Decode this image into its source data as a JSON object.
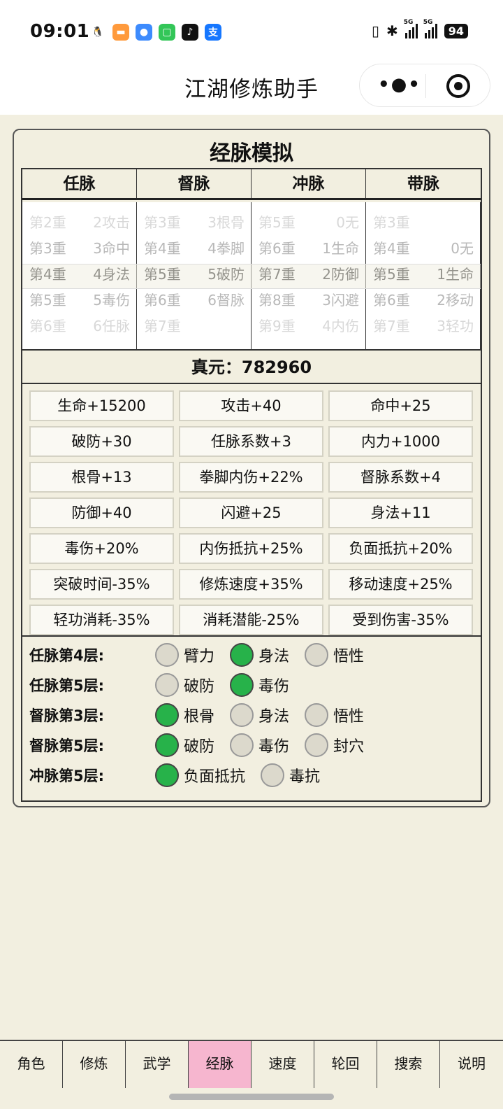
{
  "status_bar": {
    "time": "09:01",
    "apps": [
      {
        "icon": "qq-icon",
        "glyph": "🐧",
        "color": "#ffffff"
      },
      {
        "icon": "wallet-icon",
        "glyph": "▬",
        "color": "#ff9a3c"
      },
      {
        "icon": "browser-icon",
        "glyph": "●",
        "color": "#3d8bfd"
      },
      {
        "icon": "messages-icon",
        "glyph": "▢",
        "color": "#33c658"
      },
      {
        "icon": "tiktok-icon",
        "glyph": "♪",
        "color": "#111111"
      },
      {
        "icon": "alipay-icon",
        "glyph": "支",
        "color": "#1677ff"
      }
    ],
    "network": "5G",
    "battery": "94"
  },
  "header": {
    "title": "江湖修炼助手"
  },
  "panel": {
    "title": "经脉模拟",
    "columns": [
      "任脉",
      "督脉",
      "冲脉",
      "带脉"
    ],
    "pickers": [
      {
        "rows": [
          [
            "第2重",
            "2攻击"
          ],
          [
            "第3重",
            "3命中"
          ],
          [
            "第4重",
            "4身法"
          ],
          [
            "第5重",
            "5毒伤"
          ],
          [
            "第6重",
            "6任脉"
          ]
        ]
      },
      {
        "rows": [
          [
            "第3重",
            "3根骨"
          ],
          [
            "第4重",
            "4拳脚"
          ],
          [
            "第5重",
            "5破防"
          ],
          [
            "第6重",
            "6督脉"
          ],
          [
            "第7重",
            ""
          ]
        ]
      },
      {
        "rows": [
          [
            "第5重",
            "0无"
          ],
          [
            "第6重",
            "1生命"
          ],
          [
            "第7重",
            "2防御"
          ],
          [
            "第8重",
            "3闪避"
          ],
          [
            "第9重",
            "4内伤"
          ]
        ]
      },
      {
        "rows": [
          [
            "第3重",
            ""
          ],
          [
            "第4重",
            "0无"
          ],
          [
            "第5重",
            "1生命"
          ],
          [
            "第6重",
            "2移动"
          ],
          [
            "第7重",
            "3轻功"
          ]
        ]
      }
    ],
    "zhenyuan": "真元：782960",
    "stats": [
      "生命+15200",
      "攻击+40",
      "命中+25",
      "破防+30",
      "任脉系数+3",
      "内力+1000",
      "根骨+13",
      "拳脚内伤+22%",
      "督脉系数+4",
      "防御+40",
      "闪避+25",
      "身法+11",
      "毒伤+20%",
      "内伤抵抗+25%",
      "负面抵抗+20%",
      "突破时间-35%",
      "修炼速度+35%",
      "移动速度+25%",
      "轻功消耗-35%",
      "消耗潜能-25%",
      "受到伤害-35%"
    ],
    "nodes": [
      {
        "label": "任脉第4层:",
        "options": [
          {
            "text": "臂力",
            "on": false
          },
          {
            "text": "身法",
            "on": true
          },
          {
            "text": "悟性",
            "on": false
          }
        ]
      },
      {
        "label": "任脉第5层:",
        "options": [
          {
            "text": "破防",
            "on": false
          },
          {
            "text": "毒伤",
            "on": true
          }
        ]
      },
      {
        "label": "督脉第3层:",
        "options": [
          {
            "text": "根骨",
            "on": true
          },
          {
            "text": "身法",
            "on": false
          },
          {
            "text": "悟性",
            "on": false
          }
        ]
      },
      {
        "label": "督脉第5层:",
        "options": [
          {
            "text": "破防",
            "on": true
          },
          {
            "text": "毒伤",
            "on": false
          },
          {
            "text": "封穴",
            "on": false
          }
        ]
      },
      {
        "label": "冲脉第5层:",
        "options": [
          {
            "text": "负面抵抗",
            "on": true
          },
          {
            "text": "毒抗",
            "on": false
          }
        ]
      }
    ]
  },
  "tabs": [
    "角色",
    "修炼",
    "武学",
    "经脉",
    "速度",
    "轮回",
    "搜索",
    "说明"
  ],
  "active_tab": 3,
  "colors": {
    "background": "#f2efe0",
    "active_tab": "#f6b6cf",
    "radio_on": "#27b24a",
    "radio_off": "#dcd9cc"
  }
}
